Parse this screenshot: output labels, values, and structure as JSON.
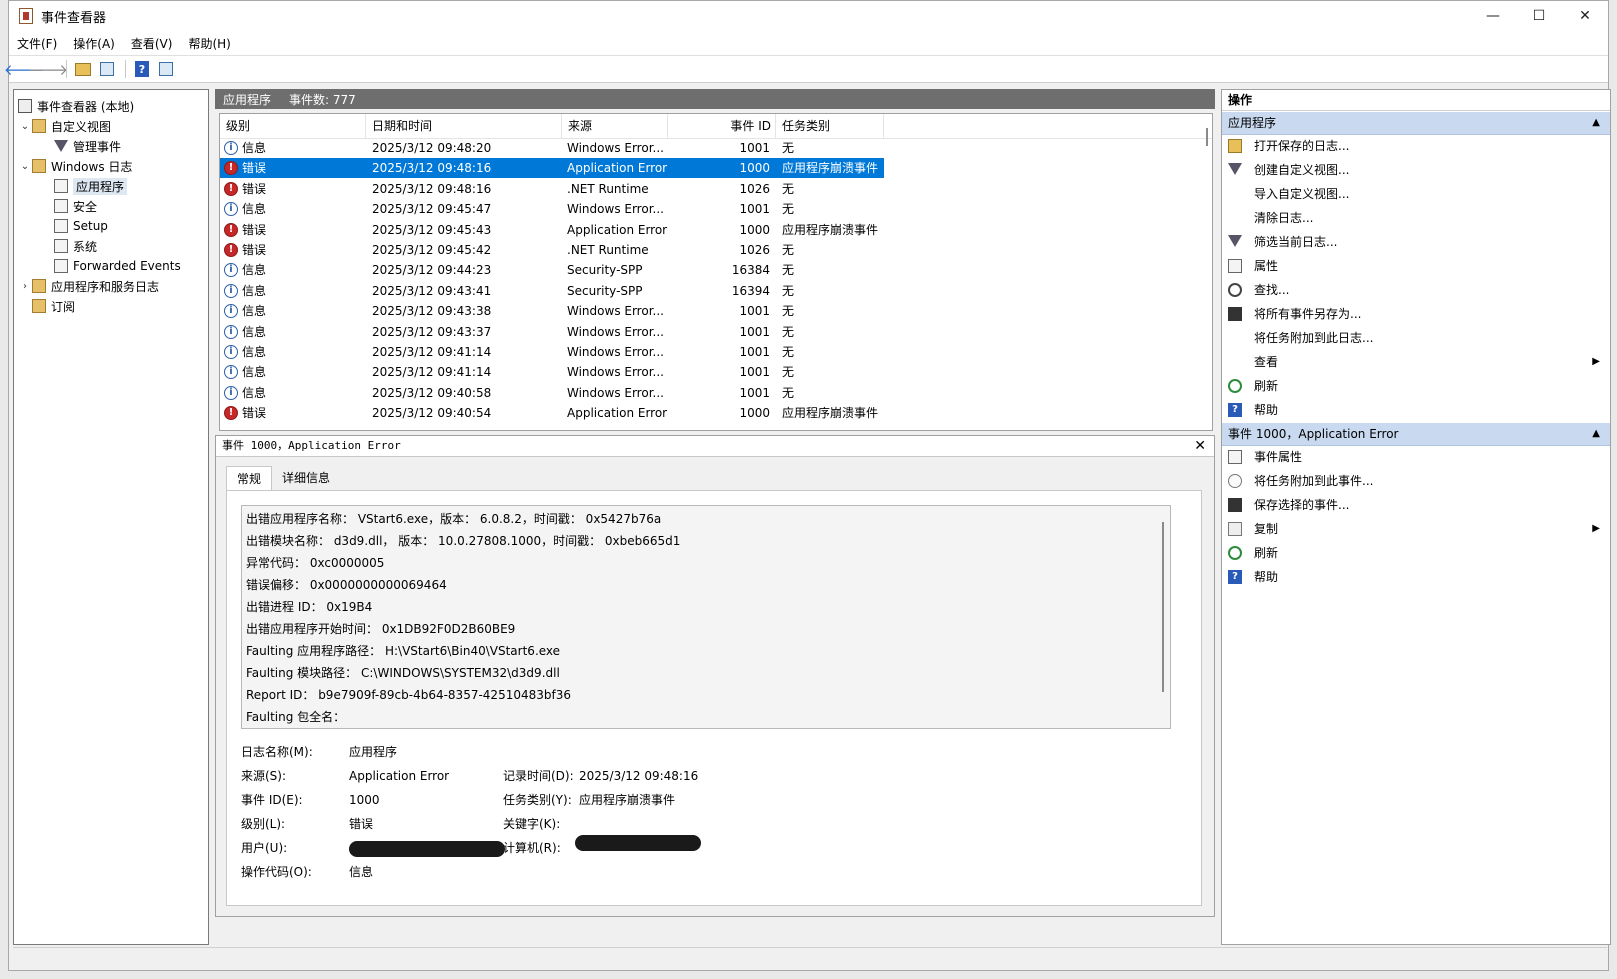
{
  "window": {
    "title": "事件查看器"
  },
  "window_controls": {
    "minimize": "—",
    "maximize": "☐",
    "close": "✕"
  },
  "menu": [
    "文件(F)",
    "操作(A)",
    "查看(V)",
    "帮助(H)"
  ],
  "tree": {
    "root": "事件查看器 (本地)",
    "custom_views": "自定义视图",
    "admin_events": "管理事件",
    "windows_logs": "Windows 日志",
    "application": "应用程序",
    "security": "安全",
    "setup": "Setup",
    "system": "系统",
    "forwarded": "Forwarded Events",
    "app_service_logs": "应用程序和服务日志",
    "subscriptions": "订阅"
  },
  "log_header": {
    "name": "应用程序",
    "count": "事件数: 777"
  },
  "grid": {
    "columns": [
      "级别",
      "日期和时间",
      "来源",
      "事件 ID",
      "任务类别"
    ],
    "rows": [
      {
        "level": "信息",
        "type": "info",
        "datetime": "2025/3/12 09:48:20",
        "source": "Windows Error...",
        "id": "1001",
        "task": "无"
      },
      {
        "level": "错误",
        "type": "error",
        "datetime": "2025/3/12 09:48:16",
        "source": "Application Error",
        "id": "1000",
        "task": "应用程序崩溃事件",
        "selected": true
      },
      {
        "level": "错误",
        "type": "error",
        "datetime": "2025/3/12 09:48:16",
        "source": ".NET Runtime",
        "id": "1026",
        "task": "无"
      },
      {
        "level": "信息",
        "type": "info",
        "datetime": "2025/3/12 09:45:47",
        "source": "Windows Error...",
        "id": "1001",
        "task": "无"
      },
      {
        "level": "错误",
        "type": "error",
        "datetime": "2025/3/12 09:45:43",
        "source": "Application Error",
        "id": "1000",
        "task": "应用程序崩溃事件"
      },
      {
        "level": "错误",
        "type": "error",
        "datetime": "2025/3/12 09:45:42",
        "source": ".NET Runtime",
        "id": "1026",
        "task": "无"
      },
      {
        "level": "信息",
        "type": "info",
        "datetime": "2025/3/12 09:44:23",
        "source": "Security-SPP",
        "id": "16384",
        "task": "无"
      },
      {
        "level": "信息",
        "type": "info",
        "datetime": "2025/3/12 09:43:41",
        "source": "Security-SPP",
        "id": "16394",
        "task": "无"
      },
      {
        "level": "信息",
        "type": "info",
        "datetime": "2025/3/12 09:43:38",
        "source": "Windows Error...",
        "id": "1001",
        "task": "无"
      },
      {
        "level": "信息",
        "type": "info",
        "datetime": "2025/3/12 09:43:37",
        "source": "Windows Error...",
        "id": "1001",
        "task": "无"
      },
      {
        "level": "信息",
        "type": "info",
        "datetime": "2025/3/12 09:41:14",
        "source": "Windows Error...",
        "id": "1001",
        "task": "无"
      },
      {
        "level": "信息",
        "type": "info",
        "datetime": "2025/3/12 09:41:14",
        "source": "Windows Error...",
        "id": "1001",
        "task": "无"
      },
      {
        "level": "信息",
        "type": "info",
        "datetime": "2025/3/12 09:40:58",
        "source": "Windows Error...",
        "id": "1001",
        "task": "无"
      },
      {
        "level": "错误",
        "type": "error",
        "datetime": "2025/3/12 09:40:54",
        "source": "Application Error",
        "id": "1000",
        "task": "应用程序崩溃事件"
      }
    ]
  },
  "detail": {
    "title": "事件 1000，Application Error",
    "tabs": [
      "常规",
      "详细信息"
    ],
    "message_lines": [
      "出错应用程序名称： VStart6.exe，版本： 6.0.8.2，时间戳： 0x5427b76a",
      "出错模块名称： d3d9.dll， 版本： 10.0.27808.1000，时间戳： 0xbeb665d1",
      "异常代码： 0xc0000005",
      "错误偏移： 0x0000000000069464",
      "出错进程 ID： 0x19B4",
      "出错应用程序开始时间： 0x1DB92F0D2B60BE9",
      "Faulting 应用程序路径： H:\\VStart6\\Bin40\\VStart6.exe",
      "Faulting 模块路径： C:\\WINDOWS\\SYSTEM32\\d3d9.dll",
      "Report ID： b9e7909f-89cb-4b64-8357-42510483bf36",
      "Faulting 包全名："
    ],
    "fields": {
      "log_name_label": "日志名称(M):",
      "log_name": "应用程序",
      "source_label": "来源(S):",
      "source": "Application Error",
      "logged_label": "记录时间(D):",
      "logged": "2025/3/12 09:48:16",
      "event_id_label": "事件 ID(E):",
      "event_id": "1000",
      "task_label": "任务类别(Y):",
      "task": "应用程序崩溃事件",
      "level_label": "级别(L):",
      "level": "错误",
      "keywords_label": "关键字(K):",
      "user_label": "用户(U):",
      "computer_label": "计算机(R):",
      "opcode_label": "操作代码(O):",
      "opcode": "信息"
    }
  },
  "actions": {
    "title": "操作",
    "section1": "应用程序",
    "items1": [
      {
        "label": "打开保存的日志...",
        "icon": "open-icon"
      },
      {
        "label": "创建自定义视图...",
        "icon": "filter-icon"
      },
      {
        "label": "导入自定义视图...",
        "icon": ""
      },
      {
        "label": "清除日志...",
        "icon": ""
      },
      {
        "label": "筛选当前日志...",
        "icon": "filter-icon"
      },
      {
        "label": "属性",
        "icon": "properties-icon"
      },
      {
        "label": "查找...",
        "icon": "find-icon"
      },
      {
        "label": "将所有事件另存为...",
        "icon": "save-icon"
      },
      {
        "label": "将任务附加到此日志...",
        "icon": ""
      },
      {
        "label": "查看",
        "icon": "",
        "submenu": true
      },
      {
        "label": "刷新",
        "icon": "refresh-icon"
      },
      {
        "label": "帮助",
        "icon": "help-icon"
      }
    ],
    "section2": "事件 1000，Application Error",
    "items2": [
      {
        "label": "事件属性",
        "icon": "properties-icon"
      },
      {
        "label": "将任务附加到此事件...",
        "icon": "task-icon"
      },
      {
        "label": "保存选择的事件...",
        "icon": "save-icon"
      },
      {
        "label": "复制",
        "icon": "copy-icon",
        "submenu": true
      },
      {
        "label": "刷新",
        "icon": "refresh-icon"
      },
      {
        "label": "帮助",
        "icon": "help-icon"
      }
    ]
  }
}
